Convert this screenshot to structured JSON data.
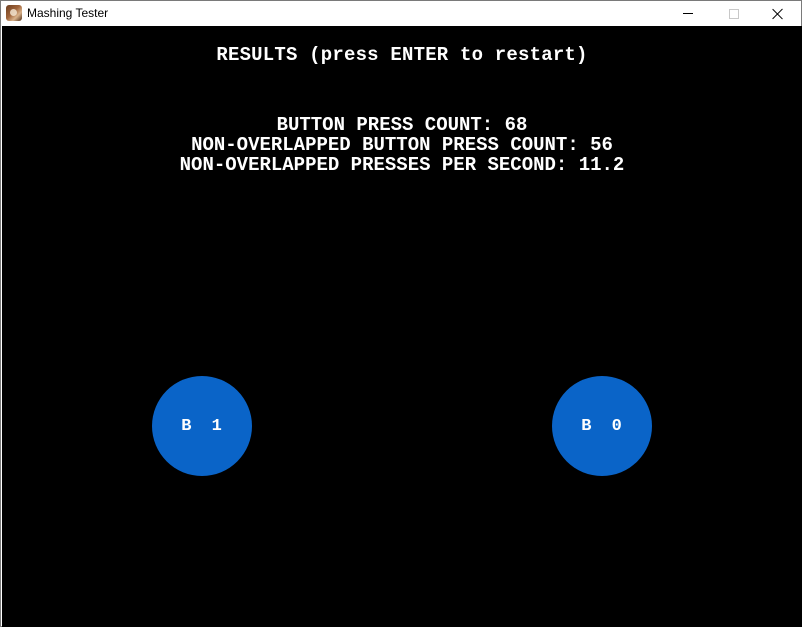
{
  "window": {
    "title": "Mashing Tester",
    "icon": "app-photo-icon"
  },
  "controls": {
    "minimize_icon": "minimize-icon",
    "maximize_icon": "maximize-icon",
    "close_icon": "close-icon"
  },
  "game": {
    "background": "#000000",
    "heading": "RESULTS (press ENTER to restart)",
    "stats": [
      "BUTTON PRESS COUNT: 68",
      "NON-OVERLAPPED BUTTON PRESS COUNT: 56",
      "NON-OVERLAPPED PRESSES PER SECOND: 11.2"
    ],
    "buttons": [
      {
        "label": "B 1",
        "color": "#0a64c8"
      },
      {
        "label": "B 0",
        "color": "#0a64c8"
      }
    ]
  }
}
